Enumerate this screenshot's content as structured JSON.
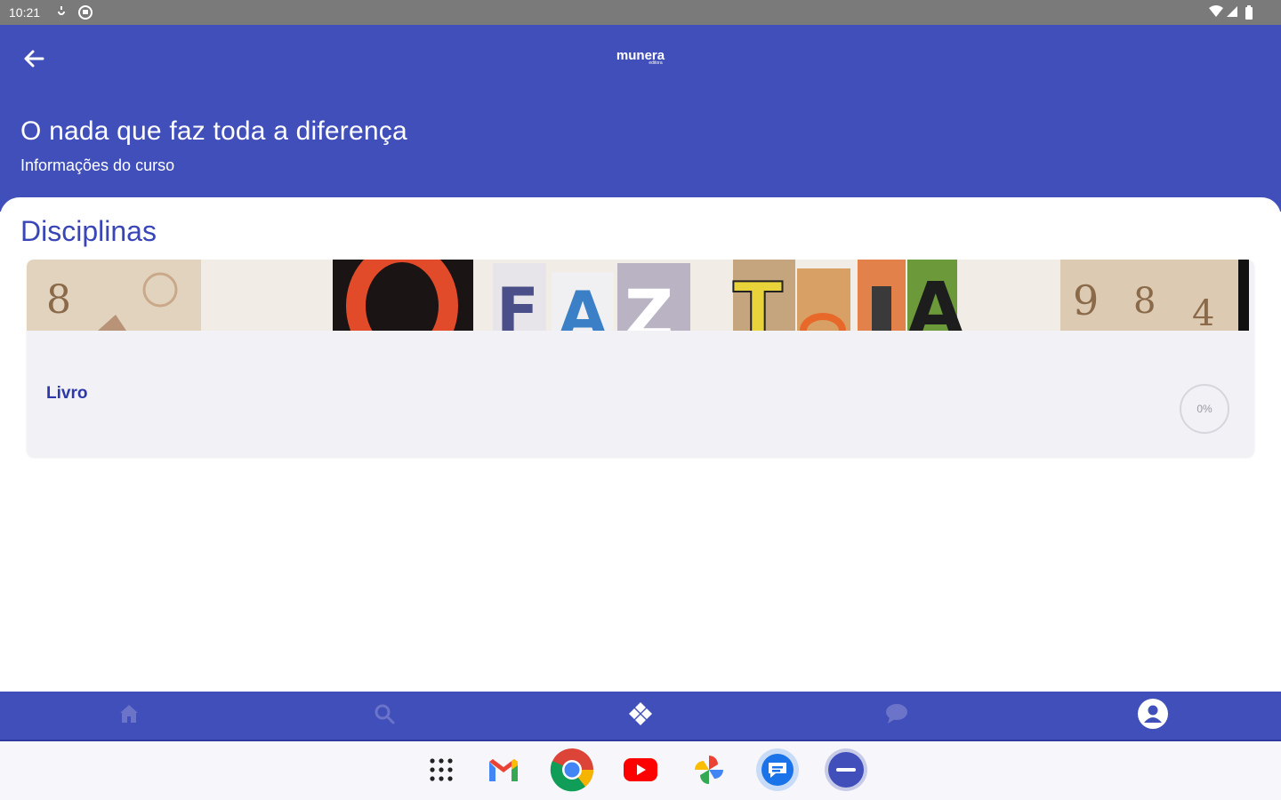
{
  "status_bar": {
    "time": "10:21",
    "left_icons": [
      "sync-icon",
      "shield-icon"
    ],
    "right_icons": [
      "wifi-icon",
      "signal-icon",
      "battery-icon"
    ]
  },
  "header": {
    "logo_text": "munera",
    "logo_subtext": "editora",
    "title": "O nada que faz toda a diferença",
    "subtitle": "Informações do curso"
  },
  "content": {
    "section_title": "Disciplinas",
    "card": {
      "label": "Livro",
      "progress": "0%",
      "progress_value": 0
    }
  },
  "bottom_nav": {
    "items": [
      "home-icon",
      "search-icon",
      "courses-icon",
      "chat-icon",
      "profile-icon"
    ],
    "active": "profile-icon"
  },
  "taskbar": {
    "apps": [
      "app-drawer",
      "gmail",
      "chrome",
      "youtube",
      "photos",
      "messages",
      "munera"
    ]
  },
  "colors": {
    "primary": "#404fba",
    "accent_text": "#2d39a8",
    "card_bg": "#f2f1f6",
    "status_bar": "#7a7a7a"
  }
}
